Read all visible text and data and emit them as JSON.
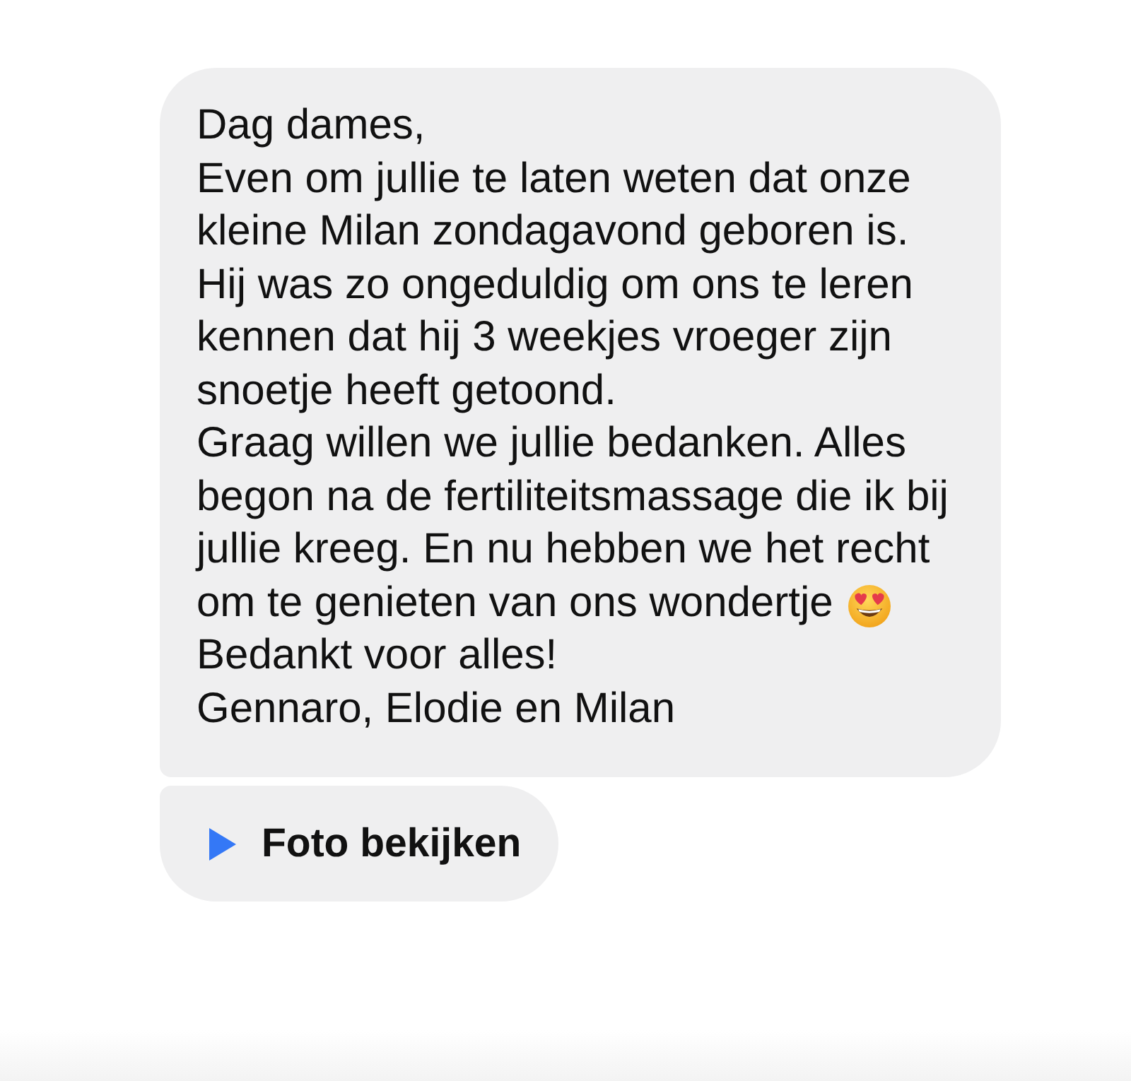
{
  "message": {
    "paragraphs": [
      {
        "lines": [
          "Dag dames,"
        ],
        "trailing_emoji": false
      },
      {
        "lines": [
          "Even om jullie te laten weten dat onze",
          "kleine Milan zondagavond geboren is.",
          "Hij was zo ongeduldig om ons te leren",
          "kennen dat hij 3 weekjes vroeger zijn",
          "snoetje heeft getoond."
        ],
        "trailing_emoji": false
      },
      {
        "lines": [
          "Graag willen we jullie bedanken. Alles",
          "begon na de fertiliteitsmassage die ik bij",
          "jullie kreeg. En nu hebben we het recht",
          "om te genieten van ons wondertje"
        ],
        "trailing_emoji": true
      },
      {
        "lines": [
          "Bedankt voor alles!"
        ],
        "trailing_emoji": false
      },
      {
        "lines": [
          "Gennaro, Elodie en Milan"
        ],
        "trailing_emoji": false
      }
    ]
  },
  "attachment": {
    "label": "Foto bekijken"
  }
}
